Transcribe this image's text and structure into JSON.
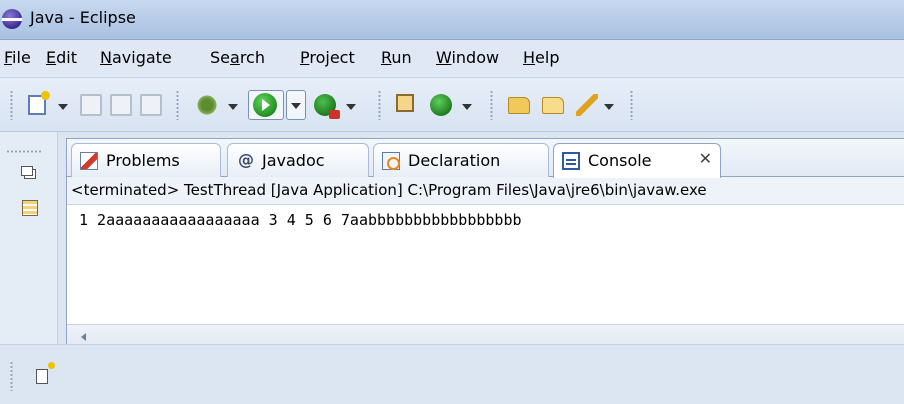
{
  "window": {
    "title": "Java - Eclipse",
    "icon": "eclipse-icon"
  },
  "menubar": {
    "items": [
      {
        "label": "File",
        "mnemonic": "F",
        "rest": "ile"
      },
      {
        "label": "Edit",
        "mnemonic": "E",
        "rest": "dit"
      },
      {
        "label": "Navigate",
        "mnemonic": "N",
        "rest": "avigate"
      },
      {
        "label": "Search",
        "pre": "Se",
        "mnemonic": "a",
        "rest": "rch"
      },
      {
        "label": "Project",
        "mnemonic": "P",
        "rest": "roject"
      },
      {
        "label": "Run",
        "mnemonic": "R",
        "rest": "un"
      },
      {
        "label": "Window",
        "mnemonic": "W",
        "rest": "indow"
      },
      {
        "label": "Help",
        "mnemonic": "H",
        "rest": "elp"
      }
    ]
  },
  "toolbar": {
    "icons": [
      "new-wizard-icon",
      "save-icon",
      "save-all-icon",
      "print-icon",
      "debug-icon",
      "run-icon",
      "external-tools-icon",
      "new-java-package-icon",
      "new-java-class-icon",
      "open-type-icon",
      "open-task-icon",
      "search-icon"
    ]
  },
  "tabs": [
    {
      "label": "Problems",
      "icon": "problems-icon",
      "active": false
    },
    {
      "label": "Javadoc",
      "icon": "javadoc-icon",
      "active": false
    },
    {
      "label": "Declaration",
      "icon": "declaration-icon",
      "active": false
    },
    {
      "label": "Console",
      "icon": "console-icon",
      "active": true,
      "close": "✕"
    }
  ],
  "console": {
    "status": "<terminated> TestThread [Java Application] C:\\Program Files\\Java\\jre6\\bin\\javaw.exe",
    "output": "1 2aaaaaaaaaaaaaaaaa 3 4 5 6 7aabbbbbbbbbbbbbbbbb"
  }
}
